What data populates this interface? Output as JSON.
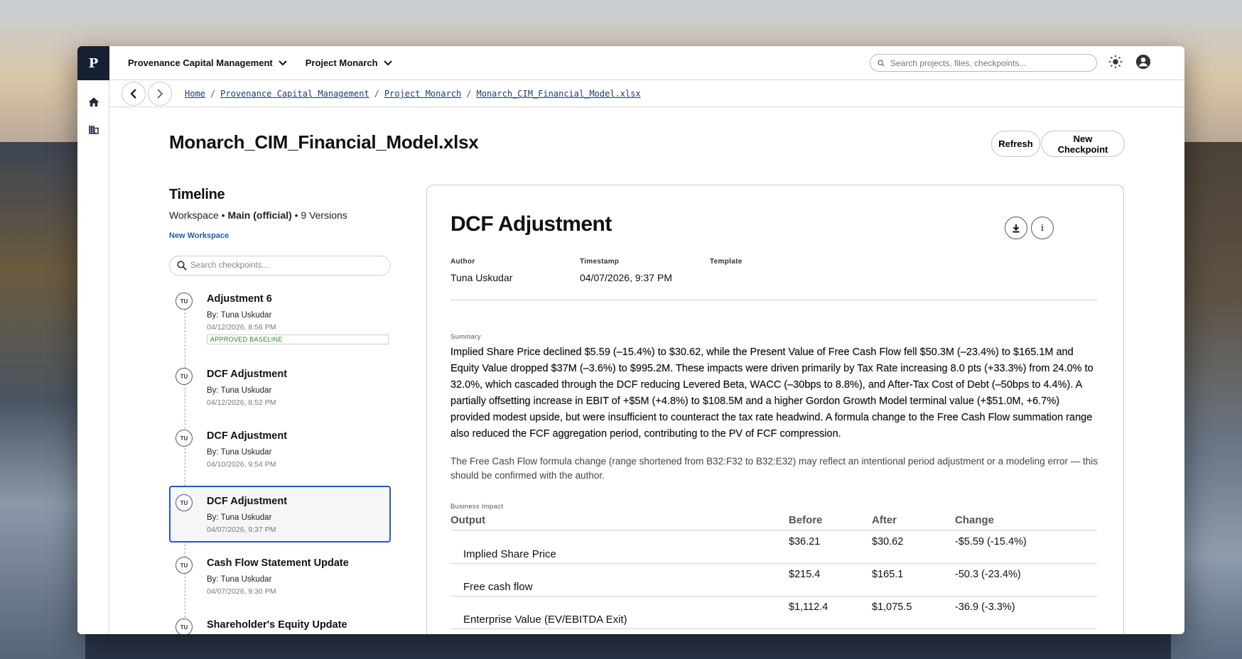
{
  "rail": {
    "logo": "P"
  },
  "topbar": {
    "org": "Provenance Capital Management",
    "project": "Project Monarch",
    "search_placeholder": "Search projects, files, checkpoints..."
  },
  "breadcrumb": [
    "Home",
    "Provenance Capital Management",
    "Project Monarch",
    "Monarch_CIM_Financial_Model.xlsx"
  ],
  "page": {
    "title": "Monarch_CIM_Financial_Model.xlsx",
    "refresh_label": "Refresh",
    "new_checkpoint_label": "New Checkpoint"
  },
  "timeline": {
    "heading": "Timeline",
    "workspace_label": "Workspace",
    "branch": "Main (official)",
    "versions": "9 Versions",
    "new_workspace": "New Workspace",
    "search_placeholder": "Search checkpoints...",
    "checkpoints": [
      {
        "initials": "TU",
        "title": "Adjustment 6",
        "by": "By: Tuna Uskudar",
        "date": "04/12/2026, 8:56 PM",
        "badge": "APPROVED BASELINE"
      },
      {
        "initials": "TU",
        "title": "DCF Adjustment",
        "by": "By: Tuna Uskudar",
        "date": "04/12/2026, 8:52 PM"
      },
      {
        "initials": "TU",
        "title": "DCF Adjustment",
        "by": "By: Tuna Uskudar",
        "date": "04/10/2026, 9:54 PM"
      },
      {
        "initials": "TU",
        "title": "DCF Adjustment",
        "by": "By: Tuna Uskudar",
        "date": "04/07/2026, 9:37 PM",
        "selected": true
      },
      {
        "initials": "TU",
        "title": "Cash Flow Statement Update",
        "by": "By: Tuna Uskudar",
        "date": "04/07/2026, 9:30 PM"
      },
      {
        "initials": "TU",
        "title": "Shareholder's Equity Update",
        "by": "",
        "date": ""
      }
    ]
  },
  "detail": {
    "title": "DCF Adjustment",
    "author_label": "Author",
    "author": "Tuna Uskudar",
    "timestamp_label": "Timestamp",
    "timestamp": "04/07/2026, 9:37 PM",
    "template_label": "Template",
    "summary_label": "Summary",
    "summary": "Implied Share Price declined $5.59 (–15.4%) to $30.62, while the Present Value of Free Cash Flow fell $50.3M (–23.4%) to $165.1M and Equity Value dropped $37M (–3.6%) to $995.2M. These impacts were driven primarily by Tax Rate increasing 8.0 pts (+33.3%) from 24.0% to 32.0%, which cascaded through the DCF reducing Levered Beta, WACC (–30bps to 8.8%), and After-Tax Cost of Debt (–50bps to 4.4%). A partially offsetting increase in EBIT of +$5M (+4.8%) to $108.5M and a higher Gordon Growth Model terminal value (+$51.0M, +6.7%) provided modest upside, but were insufficient to counteract the tax rate headwind. A formula change to the Free Cash Flow summation range also reduced the FCF aggregation period, contributing to the PV of FCF compression.",
    "note": "The Free Cash Flow formula change (range shortened from B32:F32 to B32:E32) may reflect an intentional period adjustment or a modeling error — this should be confirmed with the author.",
    "impact_label": "Business Impact",
    "columns": [
      "Output",
      "Before",
      "After",
      "Change"
    ],
    "rows": [
      {
        "output": "Implied Share Price",
        "before": "$36.21",
        "after": "$30.62",
        "change": "-$5.59 (-15.4%)"
      },
      {
        "output": "Free cash flow",
        "before": "$215.4",
        "after": "$165.1",
        "change": "-50.3 (-23.4%)"
      },
      {
        "output": "Enterprise Value (EV/EBITDA Exit)",
        "before": "$1,112.4",
        "after": "$1,075.5",
        "change": "-36.9 (-3.3%)"
      }
    ]
  }
}
